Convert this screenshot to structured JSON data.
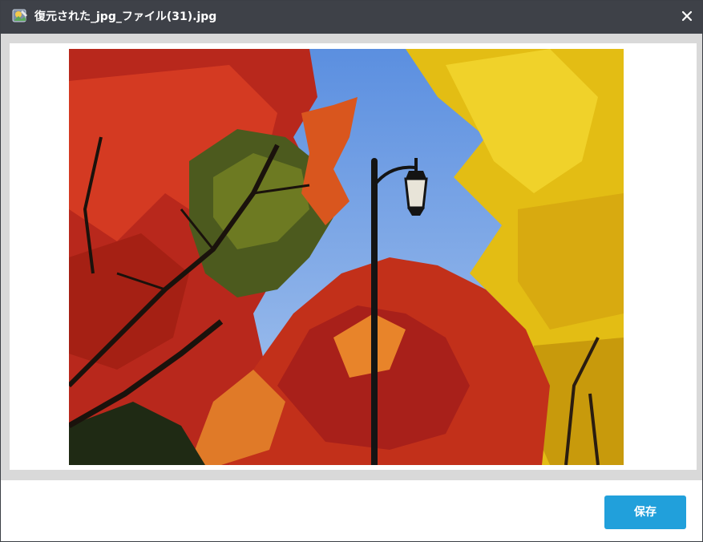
{
  "window": {
    "title": "復元された_jpg_ファイル(31).jpg",
    "icon": "recovery-app-icon",
    "close_icon": "close-icon"
  },
  "preview": {
    "image_subject": "autumn-trees-with-street-lamp-photo"
  },
  "footer": {
    "save_label": "保存"
  },
  "colors": {
    "titlebar_bg": "#3e4148",
    "preview_bg": "#d9d9d9",
    "save_button_bg": "#21a0db",
    "sky": "#6f9fe0",
    "maple_red": "#c8321e",
    "maple_orange": "#e0601e",
    "ginkgo_yellow": "#e8c41a"
  }
}
